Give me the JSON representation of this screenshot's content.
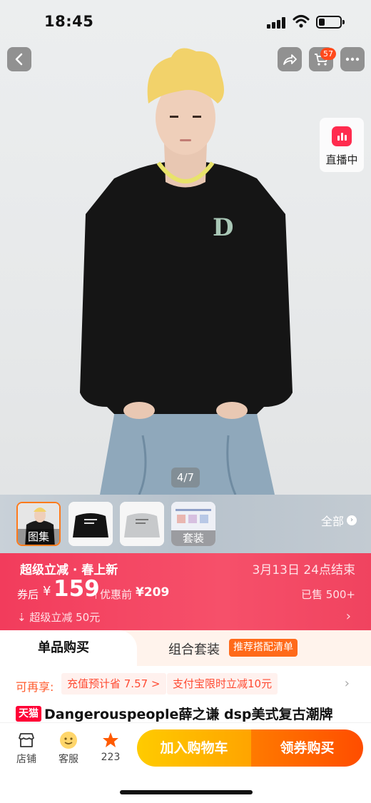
{
  "status_bar": {
    "time": "18:45"
  },
  "header": {
    "cart_count": "57"
  },
  "live": {
    "label": "直播中"
  },
  "gallery": {
    "page_indicator": "4/7"
  },
  "thumbs": {
    "items": [
      {
        "label": "图集"
      },
      {
        "label": ""
      },
      {
        "label": ""
      },
      {
        "label": "套装"
      }
    ],
    "all_label": "全部"
  },
  "promo": {
    "title": "超级立减 · 春上新",
    "end_text": "3月13日 24点结束",
    "after_label": "券后",
    "currency": "¥",
    "price": "159",
    "before_label": "优惠前",
    "before_price": "¥209",
    "sold": "已售 500+",
    "cut_text": "超级立减 50元"
  },
  "tabs": {
    "single": "单品购买",
    "combo": "组合套装",
    "recommend": "推荐搭配清单"
  },
  "benefits": {
    "label": "可再享:",
    "chip1": "充值预计省 7.57 >",
    "chip2": "支付宝限时立减10元"
  },
  "product": {
    "badge": "天猫",
    "title": "Dangerouspeople薛之谦 dsp美式复古潮牌"
  },
  "bottom_bar": {
    "store": "店铺",
    "service": "客服",
    "fav_count": "223",
    "add_cart": "加入购物车",
    "buy": "领券购买"
  },
  "colors": {
    "promo_red": "#f23c5c",
    "cart_yellow": "#ffcb00",
    "buy_orange": "#ff4d00",
    "tmall_red": "#ff0036"
  }
}
